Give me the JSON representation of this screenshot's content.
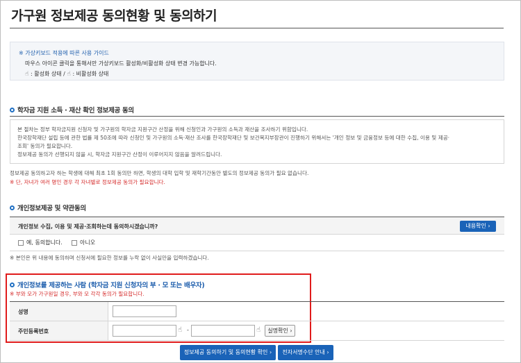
{
  "page": {
    "title": "가구원 정보제공 동의현황 및 동의하기"
  },
  "guide": {
    "title": "※ 가상키보드 적용에 따른 사용 가이드",
    "line1": "마우스 아이콘 클릭을 통해서만 가상키보드 활성화/비활성화 상태 변경 가능합니다.",
    "active_label": ": 활성화 상태 /",
    "inactive_label": ": 비활성화 상태"
  },
  "section1": {
    "title": "학자금 지원 소득 · 재산 확인 정보제공 동의",
    "body": [
      "본 절차는 정부 학자금지원 신청자 및 가구원의 학자금 지원구간 산정을 위해 신청인과 가구원의 소득과 재산을 조사하기 위함입니다.",
      "한국장학재단 설립 등에 관한 법률 제 50조에 따라 신청인 및 가구원의 소득·재산 조사를 한국장학재단 및 보건복지부장관이 진행하기 위해서는 '개인 정보 및 금융정보 등에 대한 수집, 이용 및 제공·",
      "조회' 동의가 필요합니다.",
      "정보제공 동의가 선행되지 않을 시, 학자금 지원구간 산정이 이루어지지 않음을 알려드립니다."
    ],
    "note": "정보제공 동의하고자 하는 학생에 대해 최초 1회 동의만 하면, 학생의 대학 입학 및 재학기간동안 별도의 정보제공 동의가 필요 없습니다.",
    "warning": "※ 단, 자녀가 여러 명인 경우 각 자녀별로 정보제공 동의가 필요합니다."
  },
  "section2": {
    "title": "개인정보제공 및 약관동의",
    "question": "개인정보 수집, 이용 및 제공·조회하는데 동의하시겠습니까?",
    "detail_button": "내용확인 ›",
    "option_yes": "예, 동의합니다.",
    "option_no": "아니오",
    "note": "※ 본인은 위 내용에 동의하며 신청서에 필요한 정보를 누락 없이 사실만을 입력하겠습니다."
  },
  "section3": {
    "title_prefix": "개인정보를 제공하는 사람",
    "title_suffix": "(학자금 지원 신청자의 부 · 모 또는 배우자)",
    "warning": "※ 부와 모가 가구원일 경우, 부와 모 각각 동의가 필요합니다.",
    "name_label": "성명",
    "rrn_label": "주민등록번호",
    "rrn_separator": "-",
    "verify_button": "실명확인 ›"
  },
  "footer": {
    "consent_button": "정보제공 동의하기 및 동의현황 확인 ›",
    "esign_button": "전자서명수단 안내 ›"
  },
  "colors": {
    "accent": "#1a63b8",
    "warning": "#d52b2b",
    "highlight_frame": "#e01b1b"
  }
}
